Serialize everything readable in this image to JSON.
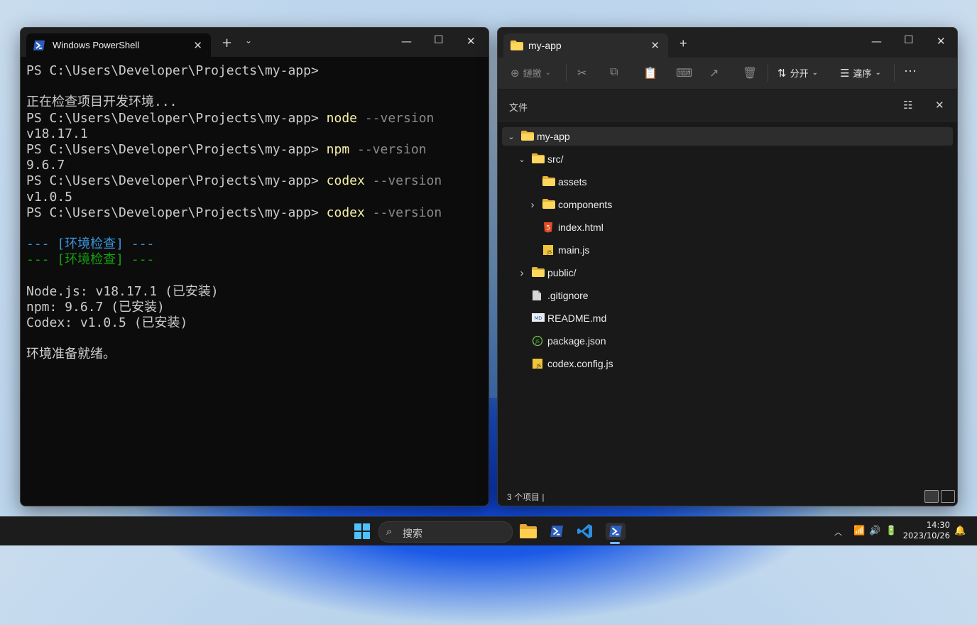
{
  "terminal": {
    "tab_title": "Windows PowerShell",
    "lines": [
      [
        {
          "t": "PS C:\\Users\\Developer\\Projects\\my-app>",
          "c": "plain"
        }
      ],
      [],
      [
        {
          "t": "正在检查项目开发环境...",
          "c": "plain"
        }
      ],
      [
        {
          "t": "PS C:\\Users\\Developer\\Projects\\my-app> ",
          "c": "plain"
        },
        {
          "t": "node",
          "c": "cmd"
        },
        {
          "t": " --version",
          "c": "param"
        }
      ],
      [
        {
          "t": "v18.17.1",
          "c": "plain"
        }
      ],
      [
        {
          "t": "PS C:\\Users\\Developer\\Projects\\my-app> ",
          "c": "plain"
        },
        {
          "t": "npm",
          "c": "cmd"
        },
        {
          "t": " --version",
          "c": "param"
        }
      ],
      [
        {
          "t": "9.6.7",
          "c": "plain"
        }
      ],
      [
        {
          "t": "PS C:\\Users\\Developer\\Projects\\my-app> ",
          "c": "plain"
        },
        {
          "t": "codex",
          "c": "cmd"
        },
        {
          "t": " --version",
          "c": "param"
        }
      ],
      [
        {
          "t": "v1.0.5",
          "c": "plain"
        }
      ],
      [
        {
          "t": "PS C:\\Users\\Developer\\Projects\\my-app> ",
          "c": "plain"
        },
        {
          "t": "codex",
          "c": "cmd"
        },
        {
          "t": " --version",
          "c": "param"
        }
      ],
      [],
      [
        {
          "t": "--- [环境检查] ---",
          "c": "cyan"
        }
      ],
      [
        {
          "t": "--- [环境检查] ---",
          "c": "green"
        }
      ],
      [],
      [
        {
          "t": "Node.js: v18.17.1 (已安装)",
          "c": "plain"
        }
      ],
      [
        {
          "t": "npm: 9.6.7 (已安装)",
          "c": "plain"
        }
      ],
      [
        {
          "t": "Codex: v1.0.5 (已安装)",
          "c": "plain"
        }
      ],
      [],
      [
        {
          "t": "环境准备就绪。",
          "c": "plain"
        }
      ]
    ]
  },
  "explorer": {
    "tab_title": "my-app",
    "toolbar": {
      "new_label": "鏈撽",
      "sort_label": "分开",
      "view_label": "違序"
    },
    "pane_title": "文件",
    "tree": [
      {
        "label": "my-app",
        "level": 0,
        "chev": "down",
        "icon": "folder",
        "selected": true
      },
      {
        "label": "src/",
        "level": 1,
        "chev": "down",
        "icon": "folder"
      },
      {
        "label": "assets",
        "level": 2,
        "chev": "",
        "icon": "folder"
      },
      {
        "label": "components",
        "level": 2,
        "chev": "right",
        "icon": "folder"
      },
      {
        "label": "index.html",
        "level": 2,
        "chev": "",
        "icon": "html"
      },
      {
        "label": "main.js",
        "level": 2,
        "chev": "",
        "icon": "js"
      },
      {
        "label": "public/",
        "level": 1,
        "chev": "right",
        "icon": "folder"
      },
      {
        "label": ".gitignore",
        "level": 1,
        "chev": "",
        "icon": "file"
      },
      {
        "label": "README.md",
        "level": 1,
        "chev": "",
        "icon": "md"
      },
      {
        "label": "package.json",
        "level": 1,
        "chev": "",
        "icon": "json"
      },
      {
        "label": "codex.config.js",
        "level": 1,
        "chev": "",
        "icon": "js"
      }
    ],
    "status": "3 个项目  |"
  },
  "taskbar": {
    "search_label": "搜索",
    "time": "14:30",
    "date": "2023/10/26"
  },
  "colors": {
    "cmd": "#f9f1a5",
    "param": "#8a8a8a",
    "cyan": "#3a96dd",
    "green": "#13a10e",
    "folder": "#f4c542"
  }
}
